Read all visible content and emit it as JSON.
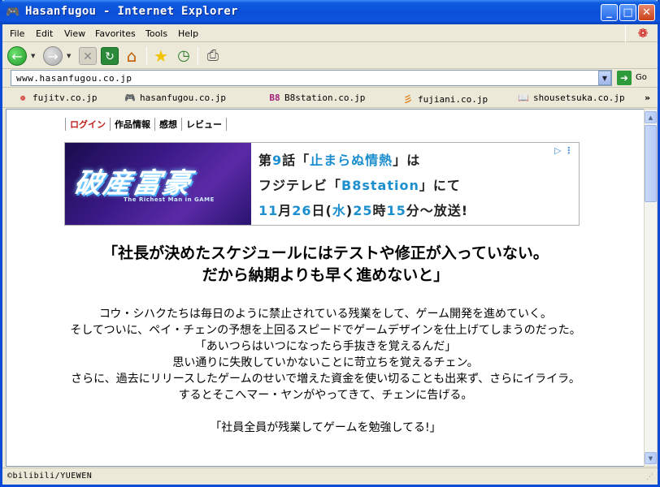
{
  "window": {
    "title": "Hasanfugou - Internet Explorer",
    "icon": "gamepad-icon",
    "min_glyph": "_",
    "max_glyph": "□",
    "close_glyph": "✕"
  },
  "menu": {
    "file": "File",
    "edit": "Edit",
    "view": "View",
    "favorites": "Favorites",
    "tools": "Tools",
    "help": "Help"
  },
  "address": {
    "url": "www.hasanfugou.co.jp",
    "go_label": "Go"
  },
  "links": [
    {
      "label": "fujitv.co.jp",
      "icon": "fujitv-eye-icon"
    },
    {
      "label": "hasanfugou.co.jp",
      "icon": "gamepad-icon"
    },
    {
      "label": "B8station.co.jp",
      "icon": "b8-logo-icon"
    },
    {
      "label": "fujiani.co.jp",
      "icon": "fujiani-logo-icon"
    },
    {
      "label": "shousetsuka.co.jp",
      "icon": "book-icon"
    }
  ],
  "page": {
    "nav": [
      "ログイン",
      "作品情報",
      "感想",
      "レビュー"
    ],
    "banner": {
      "logo": "破産富豪",
      "logo_sub": "The Richest Man in GAME",
      "line1_a": "第",
      "line1_b": "9",
      "line1_c": "話「",
      "line1_d": "止まらぬ情熱",
      "line1_e": "」は",
      "line2_a": "フジテレビ「",
      "line2_b": "B8station",
      "line2_c": "」にて",
      "line3_a": "11",
      "line3_b": "月",
      "line3_c": "26",
      "line3_d": "日(",
      "line3_e": "水",
      "line3_f": ")",
      "line3_g": "25",
      "line3_h": "時",
      "line3_i": "15",
      "line3_j": "分～放送!"
    },
    "headline_1": "「社長が決めたスケジュールにはテストや修正が入っていない。",
    "headline_2": "だから納期よりも早く進めないと」",
    "body": [
      "コウ・シハクたちは毎日のように禁止されている残業をして、ゲーム開発を進めていく。",
      "そしてついに、ペイ・チェンの予想を上回るスピードでゲームデザインを仕上げてしまうのだった。",
      "「あいつらはいつになったら手抜きを覚えるんだ」",
      "思い通りに失敗していかないことに苛立ちを覚えるチェン。",
      "さらに、過去にリリースしたゲームのせいで増えた資金を使い切ることも出来ず、さらにイライラ。",
      "するとそこへマー・ヤンがやってきて、チェンに告げる。"
    ],
    "quote": "「社員全員が残業してゲームを勉強してる!」"
  },
  "status": {
    "text": "©bilibili/YUEWEN"
  },
  "colors": {
    "titlebar": "#0b4fd6",
    "accent_blue": "#1d8fce",
    "login_red": "#c02020"
  }
}
